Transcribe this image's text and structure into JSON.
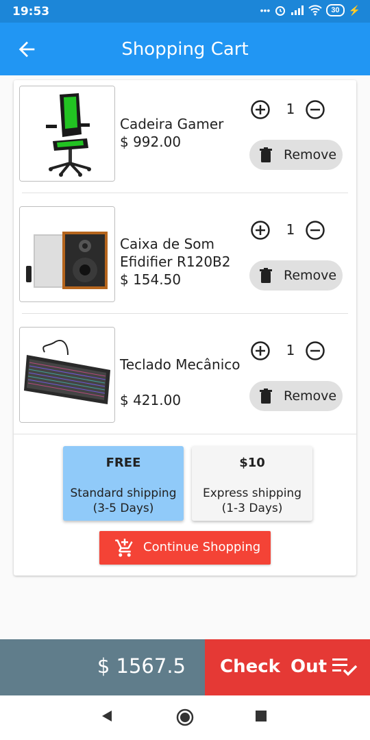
{
  "status_bar": {
    "time": "19:53",
    "battery": "30"
  },
  "app_bar": {
    "title": "Shopping Cart",
    "back_icon": "arrow-back-icon"
  },
  "colors": {
    "primary": "#2196f3",
    "accent": "#f44336",
    "checkout": "#e53935",
    "total_bg": "#607d8b",
    "selected_shipping": "#90caf9"
  },
  "cart": {
    "items": [
      {
        "name": "Cadeira Gamer",
        "price": "$ 992.00",
        "quantity": "1",
        "remove_label": "Remove"
      },
      {
        "name": "Caixa de Som Efidifier R120B2",
        "price": "$ 154.50",
        "quantity": "1",
        "remove_label": "Remove"
      },
      {
        "name": "Teclado Mecânico",
        "price": "$ 421.00",
        "quantity": "1",
        "remove_label": "Remove"
      }
    ]
  },
  "shipping": {
    "options": [
      {
        "price": "FREE",
        "label": "Standard shipping (3-5 Days)",
        "selected": true
      },
      {
        "price": "$10",
        "label": "Express shipping (1-3 Days)",
        "selected": false
      }
    ]
  },
  "continue_button": {
    "label": "Continue Shopping",
    "icon": "add-shopping-cart-icon"
  },
  "footer": {
    "total": "$ 1567.5",
    "checkout_label": "Check Out",
    "checkout_icon": "playlist-check-icon"
  }
}
